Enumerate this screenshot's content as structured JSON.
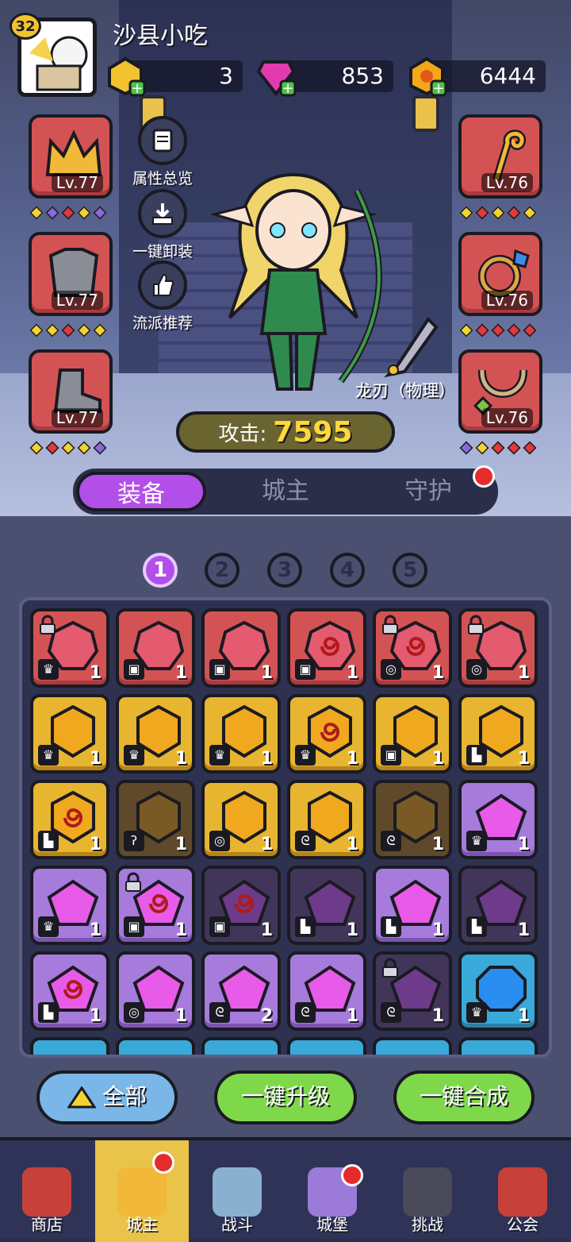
{
  "player": {
    "level": "32",
    "name": "沙县小吃"
  },
  "resources": [
    {
      "name": "gold-gem",
      "value": "3",
      "color": "#f2c230"
    },
    {
      "name": "pink-diamond",
      "value": "853",
      "color": "#e23ab0"
    },
    {
      "name": "coin",
      "value": "6444",
      "color": "#f2a818"
    }
  ],
  "slots_left": [
    {
      "icon": "crown-icon",
      "level": "Lv.77"
    },
    {
      "icon": "armor-icon",
      "level": "Lv.77"
    },
    {
      "icon": "boot-icon",
      "level": "Lv.77"
    }
  ],
  "slots_right": [
    {
      "icon": "staff-icon",
      "level": "Lv.76"
    },
    {
      "icon": "ring-icon",
      "level": "Lv.76"
    },
    {
      "icon": "necklace-icon",
      "level": "Lv.76"
    }
  ],
  "side_buttons": [
    {
      "icon": "scroll-icon",
      "label": "属性总览"
    },
    {
      "icon": "unequip-icon",
      "label": "一键卸装"
    },
    {
      "icon": "thumbs-up-icon",
      "label": "流派推荐"
    }
  ],
  "weapon": {
    "label": "龙刃（物理）"
  },
  "attack": {
    "label": "攻击:",
    "value": "7595"
  },
  "tabs": [
    "装备",
    "城主",
    "守护"
  ],
  "pages": [
    "1",
    "2",
    "3",
    "4",
    "5"
  ],
  "buttons": {
    "all": "全部",
    "upgrade": "一键升级",
    "merge": "一键合成"
  },
  "nav": [
    {
      "icon": "shop-icon",
      "label": "商店"
    },
    {
      "icon": "lord-icon",
      "label": "城主"
    },
    {
      "icon": "battle-icon",
      "label": "战斗"
    },
    {
      "icon": "castle-icon",
      "label": "城堡"
    },
    {
      "icon": "challenge-icon",
      "label": "挑战"
    },
    {
      "icon": "guild-icon",
      "label": "公会"
    }
  ],
  "gems": [
    [
      {
        "c": "red",
        "n": "1",
        "lock": true,
        "t": "♛"
      },
      {
        "c": "red",
        "n": "1",
        "t": "▣"
      },
      {
        "c": "red",
        "n": "1",
        "t": "▣"
      },
      {
        "c": "red",
        "n": "1",
        "t": "▣",
        "swirl": true
      },
      {
        "c": "red",
        "n": "1",
        "lock": true,
        "t": "◎",
        "swirl": true
      },
      {
        "c": "red",
        "n": "1",
        "lock": true,
        "t": "◎"
      }
    ],
    [
      {
        "c": "gold",
        "n": "1",
        "t": "♛"
      },
      {
        "c": "gold",
        "n": "1",
        "t": "♛"
      },
      {
        "c": "gold",
        "n": "1",
        "t": "♛"
      },
      {
        "c": "gold",
        "n": "1",
        "t": "♛",
        "swirl": true
      },
      {
        "c": "gold",
        "n": "1",
        "t": "▣"
      },
      {
        "c": "gold",
        "n": "1",
        "t": "▙"
      }
    ],
    [
      {
        "c": "gold",
        "n": "1",
        "t": "▙",
        "swirl": true
      },
      {
        "c": "dgold",
        "n": "1",
        "t": "ʔ"
      },
      {
        "c": "gold",
        "n": "1",
        "t": "◎"
      },
      {
        "c": "gold",
        "n": "1",
        "t": "ᘓ"
      },
      {
        "c": "dgold",
        "n": "1",
        "t": "ᘓ"
      },
      {
        "c": "purp",
        "n": "1",
        "t": "♛"
      }
    ],
    [
      {
        "c": "purp",
        "n": "1",
        "t": "♛"
      },
      {
        "c": "purp",
        "n": "1",
        "lock": true,
        "t": "▣",
        "swirl": true
      },
      {
        "c": "dpurp",
        "n": "1",
        "t": "▣",
        "swirl": true
      },
      {
        "c": "dpurp",
        "n": "1",
        "t": "▙"
      },
      {
        "c": "purp",
        "n": "1",
        "t": "▙"
      },
      {
        "c": "dpurp",
        "n": "1",
        "t": "▙"
      }
    ],
    [
      {
        "c": "purp",
        "n": "1",
        "t": "▙",
        "swirl": true
      },
      {
        "c": "purp",
        "n": "1",
        "t": "◎"
      },
      {
        "c": "purp",
        "n": "2",
        "t": "ᘓ"
      },
      {
        "c": "purp",
        "n": "1",
        "t": "ᘓ"
      },
      {
        "c": "dpurp",
        "n": "1",
        "lock": true,
        "t": "ᘓ"
      },
      {
        "c": "blue",
        "n": "1",
        "t": "♛"
      }
    ]
  ]
}
